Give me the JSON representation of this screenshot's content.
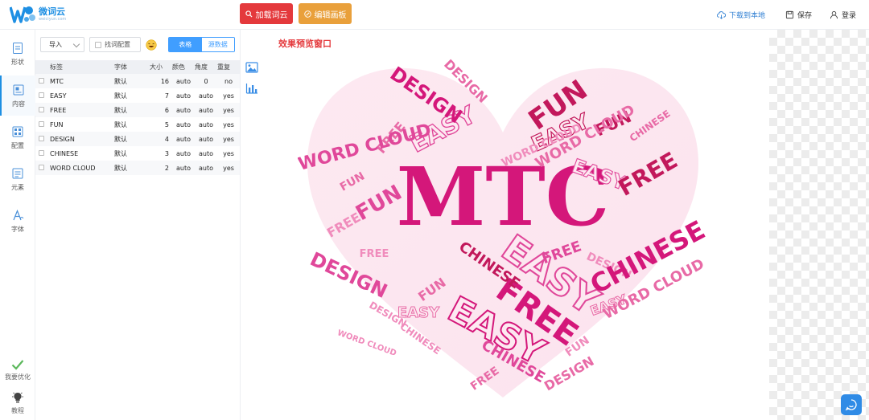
{
  "app": {
    "logo_name": "微词云",
    "logo_url": "weiciyun.com",
    "brand_color": "#1e8fe3"
  },
  "toolbar": {
    "load_label": "加载词云",
    "edit_label": "编辑画板",
    "download_label": "下载到本地",
    "save_label": "保存",
    "login_label": "登录"
  },
  "rail": {
    "shape": "形状",
    "content": "内容",
    "config": "配置",
    "element": "元素",
    "font": "字体",
    "optimize": "我要优化",
    "tutorial": "教程"
  },
  "panel": {
    "import_label": "导入",
    "find_replace": "找词配置",
    "tab_table": "表格",
    "tab_source": "源数据",
    "columns": [
      "标签",
      "字体",
      "大小",
      "颜色",
      "角度",
      "重复"
    ],
    "rows": [
      {
        "label": "MTC",
        "font": "默认",
        "size": "16",
        "color": "auto",
        "angle": "0",
        "repeat": "no"
      },
      {
        "label": "EASY",
        "font": "默认",
        "size": "7",
        "color": "auto",
        "angle": "auto",
        "repeat": "yes"
      },
      {
        "label": "FREE",
        "font": "默认",
        "size": "6",
        "color": "auto",
        "angle": "auto",
        "repeat": "yes"
      },
      {
        "label": "FUN",
        "font": "默认",
        "size": "5",
        "color": "auto",
        "angle": "auto",
        "repeat": "yes"
      },
      {
        "label": "DESIGN",
        "font": "默认",
        "size": "4",
        "color": "auto",
        "angle": "auto",
        "repeat": "yes"
      },
      {
        "label": "CHINESE",
        "font": "默认",
        "size": "3",
        "color": "auto",
        "angle": "auto",
        "repeat": "yes"
      },
      {
        "label": "WORD CLOUD",
        "font": "默认",
        "size": "2",
        "color": "auto",
        "angle": "auto",
        "repeat": "yes"
      }
    ]
  },
  "preview": {
    "title": "效果预览窗口",
    "accent_color": "#d4177a"
  }
}
